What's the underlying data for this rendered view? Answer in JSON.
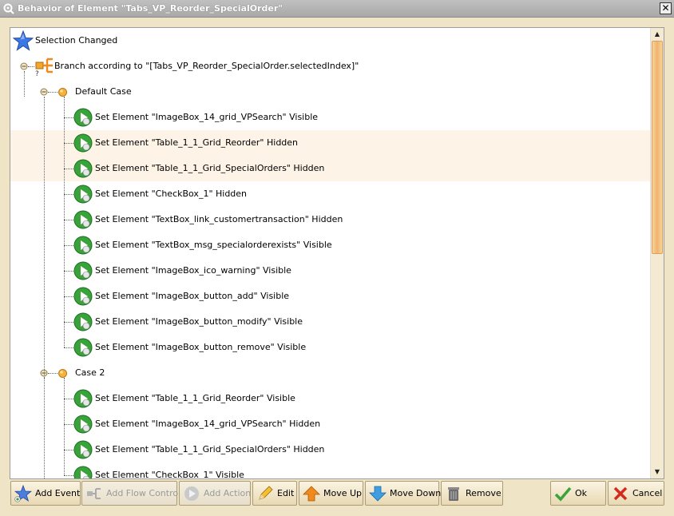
{
  "window": {
    "title": "Behavior of Element \"Tabs_VP_Reorder_SpecialOrder\"",
    "close_glyph": "✕"
  },
  "tree": {
    "event": {
      "label": "Selection Changed",
      "icon": "star-icon"
    },
    "branch": {
      "label": "Branch according to \"[Tabs_VP_Reorder_SpecialOrder.selectedIndex]\"",
      "icon": "branch-icon"
    },
    "cases": [
      {
        "label": "Default Case",
        "actions": [
          {
            "label": "Set Element \"ImageBox_14_grid_VPSearch\" Visible",
            "highlighted": false
          },
          {
            "label": "Set Element \"Table_1_1_Grid_Reorder\" Hidden",
            "highlighted": true
          },
          {
            "label": "Set Element \"Table_1_1_Grid_SpecialOrders\" Hidden",
            "highlighted": true
          },
          {
            "label": "Set Element \"CheckBox_1\" Hidden",
            "highlighted": false
          },
          {
            "label": "Set Element \"TextBox_link_customertransaction\" Hidden",
            "highlighted": false
          },
          {
            "label": "Set Element \"TextBox_msg_specialorderexists\" Visible",
            "highlighted": false
          },
          {
            "label": "Set Element \"ImageBox_ico_warning\" Visible",
            "highlighted": false
          },
          {
            "label": "Set Element \"ImageBox_button_add\" Visible",
            "highlighted": false
          },
          {
            "label": "Set Element \"ImageBox_button_modify\" Visible",
            "highlighted": false
          },
          {
            "label": "Set Element \"ImageBox_button_remove\" Visible",
            "highlighted": false
          }
        ]
      },
      {
        "label": "Case 2",
        "actions": [
          {
            "label": "Set Element \"Table_1_1_Grid_Reorder\" Visible",
            "highlighted": false
          },
          {
            "label": "Set Element \"ImageBox_14_grid_VPSearch\" Hidden",
            "highlighted": false
          },
          {
            "label": "Set Element \"Table_1_1_Grid_SpecialOrders\" Hidden",
            "highlighted": false
          },
          {
            "label": "Set Element \"CheckBox_1\" Visible",
            "highlighted": false
          }
        ]
      }
    ]
  },
  "toolbar": {
    "add_event": "Add Event",
    "add_flow_control": "Add Flow Control",
    "add_action": "Add Action",
    "edit": "Edit",
    "move_up": "Move Up",
    "move_down": "Move Down",
    "remove": "Remove",
    "ok": "Ok",
    "cancel": "Cancel"
  },
  "scrollbar": {
    "up_glyph": "▲",
    "down_glyph": "▼",
    "position_fraction": 0
  },
  "colors": {
    "title_bg": "#a8a8a8",
    "tree_bg": "#ffffff",
    "highlight_row": "#fdf3e6",
    "scroll_thumb": "#f0b36c",
    "action_green": "#3aa33a"
  }
}
